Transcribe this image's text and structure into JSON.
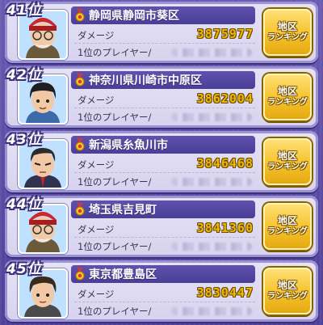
{
  "entries": [
    {
      "rank": "41位",
      "area": "静岡県静岡市葵区",
      "damage_label": "ダメージ",
      "damage": "3875977",
      "player_label": "1位のプレイヤー/",
      "button_line1": "地区",
      "button_line2": "ランキング",
      "avatar": "old-man-red-hat-icon"
    },
    {
      "rank": "42位",
      "area": "神奈川県川崎市中原区",
      "damage_label": "ダメージ",
      "damage": "3862004",
      "player_label": "1位のプレイヤー/",
      "button_line1": "地区",
      "button_line2": "ランキング",
      "avatar": "boy-black-hair-icon"
    },
    {
      "rank": "43位",
      "area": "新潟県糸魚川市",
      "damage_label": "ダメージ",
      "damage": "3846468",
      "player_label": "1位のプレイヤー/",
      "button_line1": "地区",
      "button_line2": "ランキング",
      "avatar": "man-suit-icon"
    },
    {
      "rank": "44位",
      "area": "埼玉県吉見町",
      "damage_label": "ダメージ",
      "damage": "3841360",
      "player_label": "1位のプレイヤー/",
      "button_line1": "地区",
      "button_line2": "ランキング",
      "avatar": "old-man-red-hat-icon"
    },
    {
      "rank": "45位",
      "area": "東京都豊島区",
      "damage_label": "ダメージ",
      "damage": "3830447",
      "player_label": "1位のプレイヤー/",
      "button_line1": "地区",
      "button_line2": "ランキング",
      "avatar": "man-brown-hair-icon"
    }
  ],
  "colors": {
    "background": "#5a4a9e",
    "name_bar": "#4a3e96",
    "damage_value": "#f0b800",
    "button": "#f5c22a"
  }
}
